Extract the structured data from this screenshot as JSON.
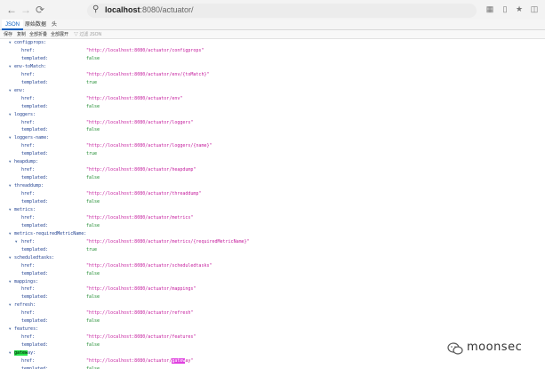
{
  "browser": {
    "url_host": "localhost",
    "url_rest": ":8080/actuator/",
    "back_icon": "arrow-left-icon",
    "forward_icon": "arrow-right-icon",
    "reload_icon": "reload-icon",
    "info_icon": "search-icon"
  },
  "viewer": {
    "tabs": [
      "JSON",
      "原始数据",
      "头"
    ],
    "toolbar": [
      "保存",
      "复制",
      "全部折叠",
      "全部展开"
    ],
    "filter_label": "过滤 JSON"
  },
  "tree": [
    {
      "name": "configprops",
      "href": "\"http://localhost:8080/actuator/configprops\"",
      "templated": "false"
    },
    {
      "name": "env-toMatch",
      "href": "\"http://localhost:8080/actuator/env/{toMatch}\"",
      "templated": "true"
    },
    {
      "name": "env",
      "href": "\"http://localhost:8080/actuator/env\"",
      "templated": "false"
    },
    {
      "name": "loggers",
      "href": "\"http://localhost:8080/actuator/loggers\"",
      "templated": "false"
    },
    {
      "name": "loggers-name",
      "href": "\"http://localhost:8080/actuator/loggers/{name}\"",
      "templated": "true"
    },
    {
      "name": "heapdump",
      "href": "\"http://localhost:8080/actuator/heapdump\"",
      "templated": "false"
    },
    {
      "name": "threaddump",
      "href": "\"http://localhost:8080/actuator/threaddump\"",
      "templated": "false"
    },
    {
      "name": "metrics",
      "href": "\"http://localhost:8080/actuator/metrics\"",
      "templated": "false"
    },
    {
      "name": "metrics-requiredMetricName",
      "href": "\"http://localhost:8080/actuator/metrics/{requiredMetricName}\"",
      "templated": "true"
    },
    {
      "name": "scheduledtasks",
      "href": "\"http://localhost:8080/actuator/scheduledtasks\"",
      "templated": "false"
    },
    {
      "name": "mappings",
      "href": "\"http://localhost:8080/actuator/mappings\"",
      "templated": "false"
    },
    {
      "name": "refresh",
      "href": "\"http://localhost:8080/actuator/refresh\"",
      "templated": "false"
    },
    {
      "name": "features",
      "href": "\"http://localhost:8080/actuator/features\"",
      "templated": "false"
    }
  ],
  "last_entry": {
    "name_highlight": "gatew",
    "name_rest": "ay:",
    "href_prefix": "\"http://localhost:8080/actuator/",
    "href_highlight": "gatew",
    "href_suffix": "ay\"",
    "templated": "false"
  },
  "labels": {
    "href": "href:",
    "templated": "templated:"
  },
  "watermark": {
    "text": "moonsec",
    "icon": "wechat-icon"
  }
}
